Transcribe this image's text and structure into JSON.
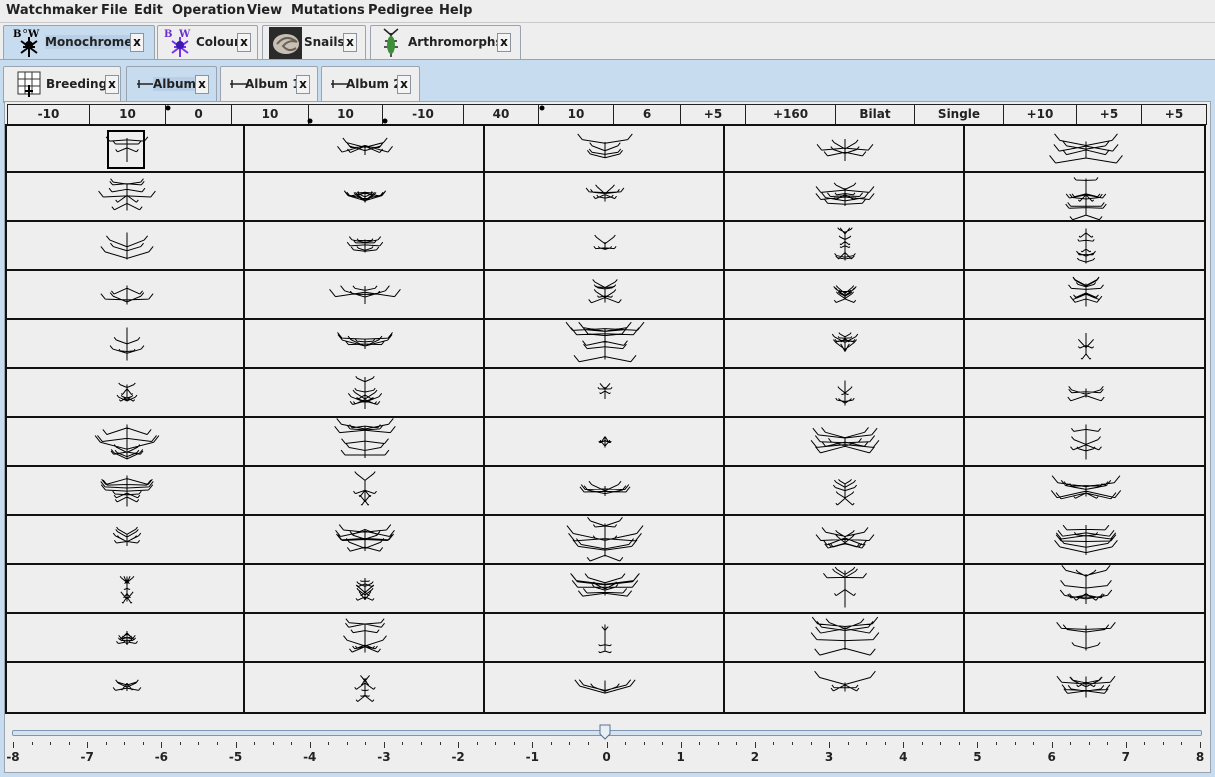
{
  "menu": [
    "Watchmaker",
    "File",
    "Edit",
    "Operation",
    "View",
    "Mutations",
    "Pedigree",
    "Help"
  ],
  "top_tabs": [
    {
      "label": "Monochrome",
      "close": "x",
      "selected": true,
      "icon": "biomorph-bw-icon"
    },
    {
      "label": "Colour",
      "close": "x",
      "selected": false,
      "icon": "biomorph-colour-icon"
    },
    {
      "label": "Snails",
      "close": "x",
      "selected": false,
      "icon": "snail-shell-icon"
    },
    {
      "label": "Arthromorphs",
      "close": "x",
      "selected": false,
      "icon": "arthromorph-icon"
    }
  ],
  "sub_tabs": [
    {
      "label": "Breeding",
      "close": "x",
      "selected": false,
      "icon": "breeding-grid-icon"
    },
    {
      "label": "Album",
      "close": "x",
      "selected": true,
      "icon": "album-icon"
    },
    {
      "label": "Album 1",
      "close": "x",
      "selected": false,
      "icon": "album-icon"
    },
    {
      "label": "Album 2",
      "close": "x",
      "selected": false,
      "icon": "album-icon"
    }
  ],
  "genes": [
    "-10",
    "10",
    "0",
    "10",
    "10",
    "-10",
    "40",
    "10",
    "6",
    "+5",
    "+160",
    "Bilat",
    "Single",
    "+10",
    "+5",
    "+5"
  ],
  "album": {
    "columns": 5,
    "rows": 12,
    "selected": {
      "col": 0,
      "row": 0
    }
  },
  "slider": {
    "value": 0,
    "min": -8,
    "max": 8,
    "labels": [
      "-8",
      "-7",
      "-6",
      "-5",
      "-4",
      "-3",
      "-2",
      "-1",
      "0",
      "1",
      "2",
      "3",
      "4",
      "5",
      "6",
      "7",
      "8"
    ]
  }
}
